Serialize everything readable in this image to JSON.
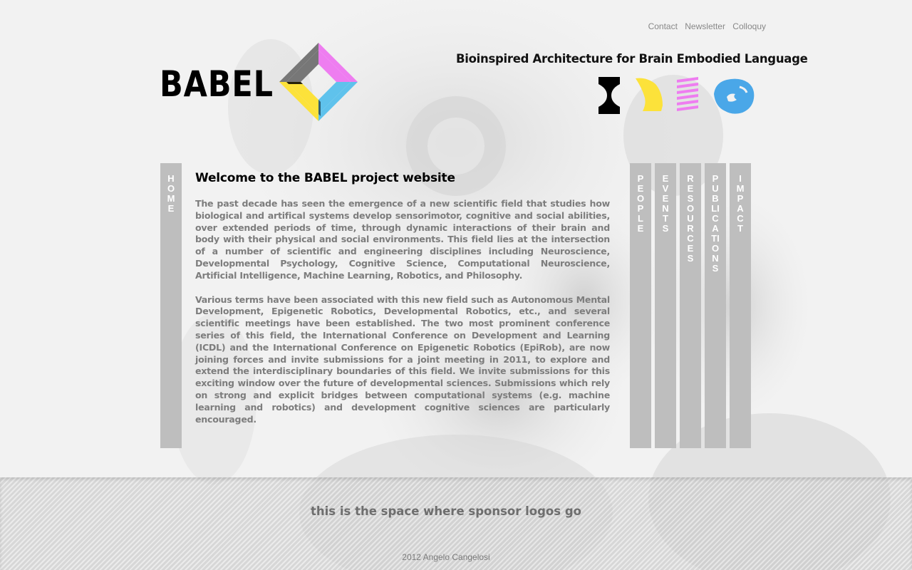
{
  "header": {
    "top_links": [
      "Contact",
      "Newsletter",
      "Colloquy"
    ],
    "logo_text": "BABEL",
    "tagline": "Bioinspired Architecture for Brain Embodied Language"
  },
  "icons": [
    "black-hourglass-icon",
    "yellow-shape-icon",
    "pink-stripes-icon",
    "blue-brain-icon"
  ],
  "nav": {
    "home": "HOME",
    "right_tabs": [
      "PEOPLE",
      "EVENTS",
      "RESOURCES",
      "PUBLICATIONS",
      "IMPACT"
    ]
  },
  "main": {
    "title": "Welcome to the BABEL project website",
    "paragraphs": [
      "The past decade has seen the emergence of a new scientific field that studies how biological and artifical systems develop sensorimotor, cognitive and social abilities, over extended periods of time, through dynamic interactions of their brain and body with their physical and social environments. This field lies at the intersection of a number of scientific and engineering disciplines including Neuroscience, Developmental Psychology, Cognitive Science, Computational Neuroscience, Artificial Intelligence, Machine Learning, Robotics, and Philosophy.",
      "Various terms have been associated with this new field such as Autonomous Mental Development, Epigenetic Robotics, Developmental Robotics, etc., and several scientific meetings have been established. The two most prominent conference series of this field, the International Conference on Development and Learning (ICDL) and the International Conference on Epigenetic Robotics (EpiRob), are now joining forces and invite submissions for a joint meeting in 2011, to explore and extend the interdisciplinary boundaries of this field. We invite submissions for this exciting window over the future of developmental sciences. Submissions which rely on strong and explicit bridges between computational systems (e.g. machine learning and robotics) and development cognitive sciences are particularly encouraged."
    ]
  },
  "footer": {
    "sponsor_text": "this is the space where sponsor logos go",
    "copyright": "2012 Angelo Cangelosi"
  },
  "colors": {
    "tab_gray": "#bebebe",
    "logo_magenta": "#ee7df0",
    "logo_cyan": "#5fc2ec",
    "logo_yellow": "#fce23a",
    "logo_dark": "#777777"
  }
}
